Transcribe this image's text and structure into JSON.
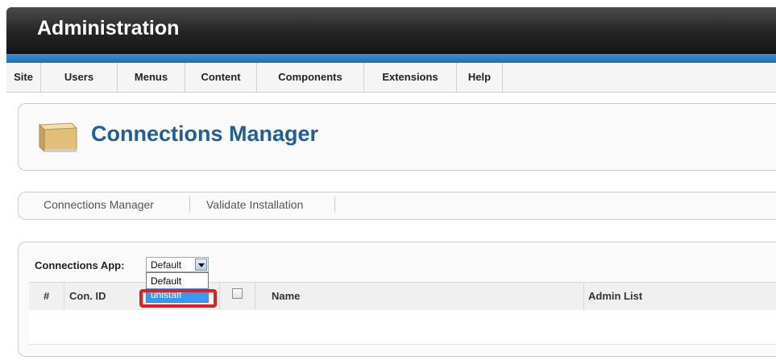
{
  "header": {
    "title": "Administration"
  },
  "menu": {
    "items": [
      {
        "label": "Site"
      },
      {
        "label": "Users"
      },
      {
        "label": "Menus"
      },
      {
        "label": "Content"
      },
      {
        "label": "Components"
      },
      {
        "label": "Extensions"
      },
      {
        "label": "Help"
      }
    ]
  },
  "page": {
    "title": "Connections Manager",
    "icon": "package-box-icon"
  },
  "submenu": {
    "items": [
      {
        "label": "Connections Manager"
      },
      {
        "label": "Validate Installation"
      }
    ]
  },
  "filter": {
    "label": "Connections App:",
    "selected": "Default",
    "options": [
      "Default",
      "unistaff"
    ],
    "highlighted_option": "unistaff"
  },
  "table": {
    "columns": [
      "#",
      "Con. ID",
      "",
      "Name",
      "Admin List"
    ],
    "rows": []
  },
  "colors": {
    "header_bg": "#242424",
    "accent_blue": "#1f5f97",
    "strip_blue": "#2a7cc7",
    "selection_blue": "#3399ff",
    "highlight_red": "#e41e1e"
  }
}
